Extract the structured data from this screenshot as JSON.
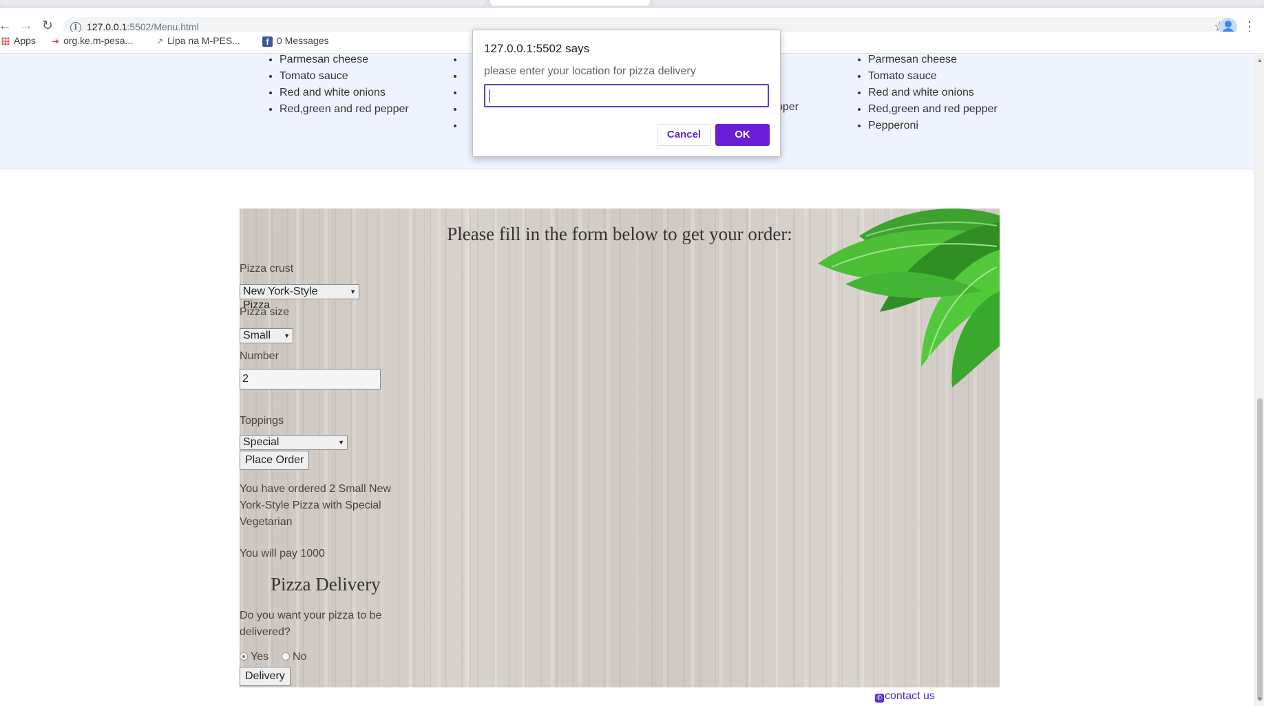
{
  "browser": {
    "url_host": "127.0.0.1",
    "url_rest": ":5502/Menu.html",
    "bookmarks": [
      {
        "label": "Apps"
      },
      {
        "label": "org.ke.m-pesa..."
      },
      {
        "label": "Lipa na M-PES..."
      },
      {
        "label": "0 Messages"
      }
    ]
  },
  "menu": {
    "left_column": [
      "Parmesan cheese",
      "Tomato sauce",
      "Red and white onions",
      "Red,green and red pepper"
    ],
    "middle_fragment": "pper",
    "right_column": [
      "Parmesan cheese",
      "Tomato sauce",
      "Red and white onions",
      "Red,green and red pepper",
      "Pepperoni"
    ]
  },
  "form": {
    "title": "Please fill in the form below to get your order:",
    "crust_label": "Pizza crust",
    "crust_value": "New York-Style Pizza",
    "size_label": "Pizza size",
    "size_value": "Small",
    "number_label": "Number",
    "number_value": "2",
    "toppings_label": "Toppings",
    "toppings_value": "Special Vegetarian",
    "place_order_label": "Place Order",
    "ordered_text": "You have ordered 2 Small New York-Style Pizza with Special Vegetarian",
    "pay_text": "You will pay 1000",
    "delivery_title": "Pizza Delivery",
    "delivery_question": "Do you want your pizza to be delivered?",
    "yes_label": "Yes",
    "no_label": "No",
    "delivery_selected": "Yes",
    "delivery_button": "Delivery"
  },
  "footer": {
    "contact": "contact us"
  },
  "dialog": {
    "title": "127.0.0.1:5502 says",
    "message": "please enter your location for pizza delivery",
    "input_value": "",
    "cancel": "Cancel",
    "ok": "OK"
  },
  "colors": {
    "accent": "#6a1fd6",
    "link": "#4b2bd6",
    "menu_band": "#eef3fd"
  }
}
